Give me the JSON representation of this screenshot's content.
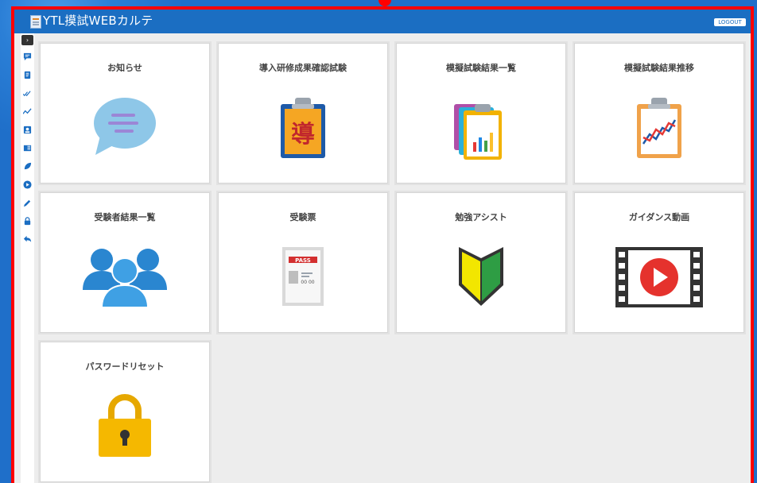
{
  "header": {
    "title": "YTL摸試WEBカルテ",
    "logout_label": "LOGOUT"
  },
  "sidebar": {
    "toggle_glyph": "›",
    "items": [
      {
        "icon": "chat-icon"
      },
      {
        "icon": "document-icon"
      },
      {
        "icon": "double-check-icon"
      },
      {
        "icon": "trend-icon"
      },
      {
        "icon": "id-card-icon"
      },
      {
        "icon": "book-icon"
      },
      {
        "icon": "leaf-icon"
      },
      {
        "icon": "play-icon"
      },
      {
        "icon": "pencil-icon"
      },
      {
        "icon": "lock-icon"
      },
      {
        "icon": "back-icon"
      }
    ]
  },
  "tiles": {
    "notice": "お知らせ",
    "training_test": "導入研修成果確認試験",
    "mock_results_list": "模擬試験結果一覧",
    "mock_results_trend": "模擬試験結果推移",
    "examinee_results_list": "受験者結果一覧",
    "exam_ticket": "受験票",
    "study_assist": "勉強アシスト",
    "guidance_video": "ガイダンス動画",
    "password_reset": "パスワードリセット"
  },
  "icon_text": {
    "training_glyph": "導",
    "pass_label": "PASS",
    "ticket_number": "00 00"
  },
  "colors": {
    "header_bg": "#1b6ec2",
    "frame_border": "#ff0000",
    "page_bg": "#ededed"
  }
}
